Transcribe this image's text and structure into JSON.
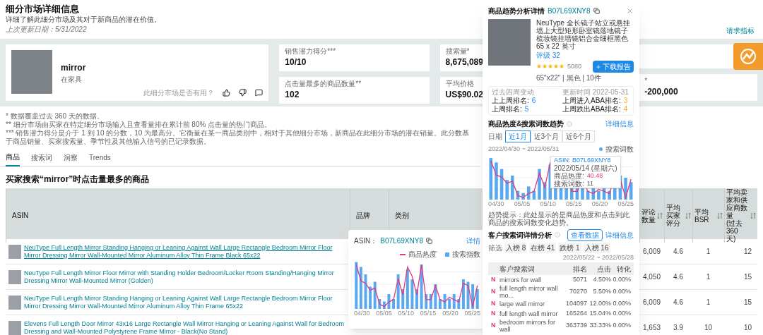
{
  "page": {
    "title": "细分市场详细信息",
    "subtitle": "详细了解此细分市场及其对于新商品的潜在价值。",
    "updated": "上次更新日期：5/31/2022",
    "request_link": "请求指标"
  },
  "segment": {
    "name": "mirror",
    "category": "在家具",
    "feedback_prompt": "此细分市场是否有用？"
  },
  "metric_columns": [
    {
      "cards": [
        {
          "label": "销售潜力得分***",
          "value": "10/10"
        },
        {
          "label": "点击量最多的商品数量**",
          "value": "102"
        }
      ]
    },
    {
      "cards": [
        {
          "label": "搜索量*",
          "value": "8,675,089"
        },
        {
          "label": "平均价格",
          "value": "US$90.02"
        }
      ]
    },
    {
      "cards": [
        {
          "label": "*",
          "value": "-200,000"
        }
      ]
    }
  ],
  "notes": [
    "* 数据覆盖过去 360 天的数据。",
    "** 细分市场由买家在特定细分市场输入且查看量排在累计前 80% 点击量的热门商品。",
    "*** 销售潜力得分是介于 1 到 10 的分数，10 为最高分。它衡量在某一商品类别中，相对于其他细分市场，新商品在此细分市场的潜在销量。此分数基于商品销量、买家搜索量、季节性及其他输入信号的已记录数据。"
  ],
  "tabs": [
    {
      "label": "商品",
      "selected": true
    },
    {
      "label": "搜索词",
      "selected": false
    },
    {
      "label": "洞察",
      "selected": false
    },
    {
      "label": "Trends",
      "selected": false
    }
  ],
  "section_title": "买家搜索“mirror”时点击量最多的商品",
  "table": {
    "columns": [
      {
        "label": "ASIN",
        "sortable": false
      },
      {
        "label": "品牌",
        "sortable": false
      },
      {
        "label": "类别",
        "sortable": false
      },
      {
        "label": "评论数量",
        "sortable": true
      },
      {
        "label": "平均买家评分",
        "sortable": true
      },
      {
        "label": "平均BSR",
        "sortable": true
      },
      {
        "label": "平均卖家和供应商数量",
        "note": "(过去 360 天)",
        "sortable": true
      }
    ],
    "rows": [
      {
        "hovered": true,
        "cells": [
          "NeuType Full Length Mirror Standing Hanging or Leaning Against Wall Large Rectangle Bedroom Mirror Floor Mirror Dressing Mirror Wall-Mounted Mirror Aluminum Alloy Thin Frame Black 65x22",
          "",
          "",
          "6,009",
          "4.6",
          "1",
          "12"
        ]
      },
      {
        "hovered": false,
        "cells": [
          "NeuType Full Length Mirror Floor Mirror with Standing Holder Bedroom/Locker Room Standing/Hanging Mirror Dressing Mirror Wall-Mounted Mirror (Golden)",
          "",
          "",
          "4,050",
          "4.6",
          "1",
          "15"
        ]
      },
      {
        "hovered": false,
        "cells": [
          "NeuType Full Length Mirror Standing Hanging or Leaning Against Wall Large Rectangle Bedroom Mirror Floor Mirror Dressing Mirror Wall-Mounted Mirror Aluminum Alloy Thin Frame 65x22",
          "",
          "",
          "6,009",
          "4.6",
          "1",
          "15"
        ]
      },
      {
        "hovered": false,
        "cells": [
          "Elevens Full Length Door Mirror 43x16 Large Rectangle Wall Mirror Hanging or Leaning Against Wall for Bedroom Dressing and Wall-Mounted Polystyrene Frame Mirror - Black(No Stand)",
          "",
          "",
          "1,653",
          "3.9",
          "10",
          "10"
        ]
      }
    ]
  },
  "popup": {
    "asin_label": "ASIN：",
    "asin": "B07L69XNY8",
    "details_link": "详情",
    "legend": [
      {
        "label": "商品热度",
        "kind": "line"
      },
      {
        "label": "搜索指数",
        "kind": "bar"
      }
    ],
    "x_labels": [
      "04/30",
      "05/05",
      "05/10",
      "05/15",
      "05/20",
      "05/25"
    ]
  },
  "drawer": {
    "title": "商品趋势分析详情",
    "asin": "B07L69XNY8",
    "product": {
      "description": "NeuType 全长镜子站立或悬挂墙上大型矩形卧室镜落地镜子梳妆镜挂墙镜铝合金细框黑色 65 x 22 英寸",
      "rank": "评级 32",
      "stars": 5,
      "reviews": "5080",
      "variant": "65\"x22\" | 黑色 | 10件",
      "button": "下载报告"
    },
    "stats": [
      {
        "header": "过去四周变动",
        "lines": [
          {
            "label": "上上周排名:",
            "value": "6"
          },
          {
            "label": "上周排名:",
            "value": "5"
          }
        ]
      },
      {
        "header": "更新时间 2022-05-31",
        "lines": [
          {
            "label": "上周进入ABA排名:",
            "value": "3"
          },
          {
            "label": "上周跌出ABA排名:",
            "value": "4"
          }
        ]
      }
    ],
    "trend": {
      "title": "商品热度&搜索词数趋势",
      "link": "详细信息",
      "filter_label": "日期",
      "ranges": [
        {
          "label": "近1月",
          "selected": true
        },
        {
          "label": "近3个月",
          "selected": false
        },
        {
          "label": "近6个月",
          "selected": false
        }
      ],
      "date_range": "2022/04/30 ~ 2022/05/31",
      "legend": "搜索词数",
      "tooltip": {
        "asin": "ASIN: B07L69XNY8",
        "date": "2022/05/14 (星期六)",
        "heat_label": "商品热度:",
        "heat": "40.48",
        "terms_label": "搜索词数:",
        "terms": "11"
      },
      "x_labels": [
        "04/30",
        "05/05",
        "05/10",
        "05/15",
        "05/20",
        "05/25"
      ],
      "note": "趋势提示：此处显示的是商品热度和点击到此商品的搜索词数变化趋势。"
    },
    "search": {
      "title": "客户搜索词详情分析",
      "button": "查看数据",
      "link": "详细信息",
      "filter_label": "筛选",
      "chips": [
        "入榜 8",
        "在榜 41",
        "跌榜 1",
        "入榜 16"
      ],
      "date_range": "2022/05/22 ~ 2022/05/28",
      "columns": [
        "客户搜索词",
        "排名",
        "点击",
        "转化"
      ],
      "rows": [
        {
          "badge": "N",
          "term": "mirrors for wall",
          "rank": "5071",
          "click": "4.50%",
          "conversion": "0.00%"
        },
        {
          "badge": "N",
          "term": "full length mirror wall mo...",
          "rank": "70270",
          "click": "5.50%",
          "conversion": "0.00%"
        },
        {
          "badge": "N",
          "term": "large wall mirror",
          "rank": "104097",
          "click": "12.00%",
          "conversion": "0.00%"
        },
        {
          "badge": "N",
          "term": "full length wall mirror",
          "rank": "165264",
          "click": "15.04%",
          "conversion": "0.00%"
        },
        {
          "badge": "N",
          "term": "bedroom mirrors for wall",
          "rank": "363739",
          "click": "33.33%",
          "conversion": "0.00%"
        }
      ]
    }
  }
}
